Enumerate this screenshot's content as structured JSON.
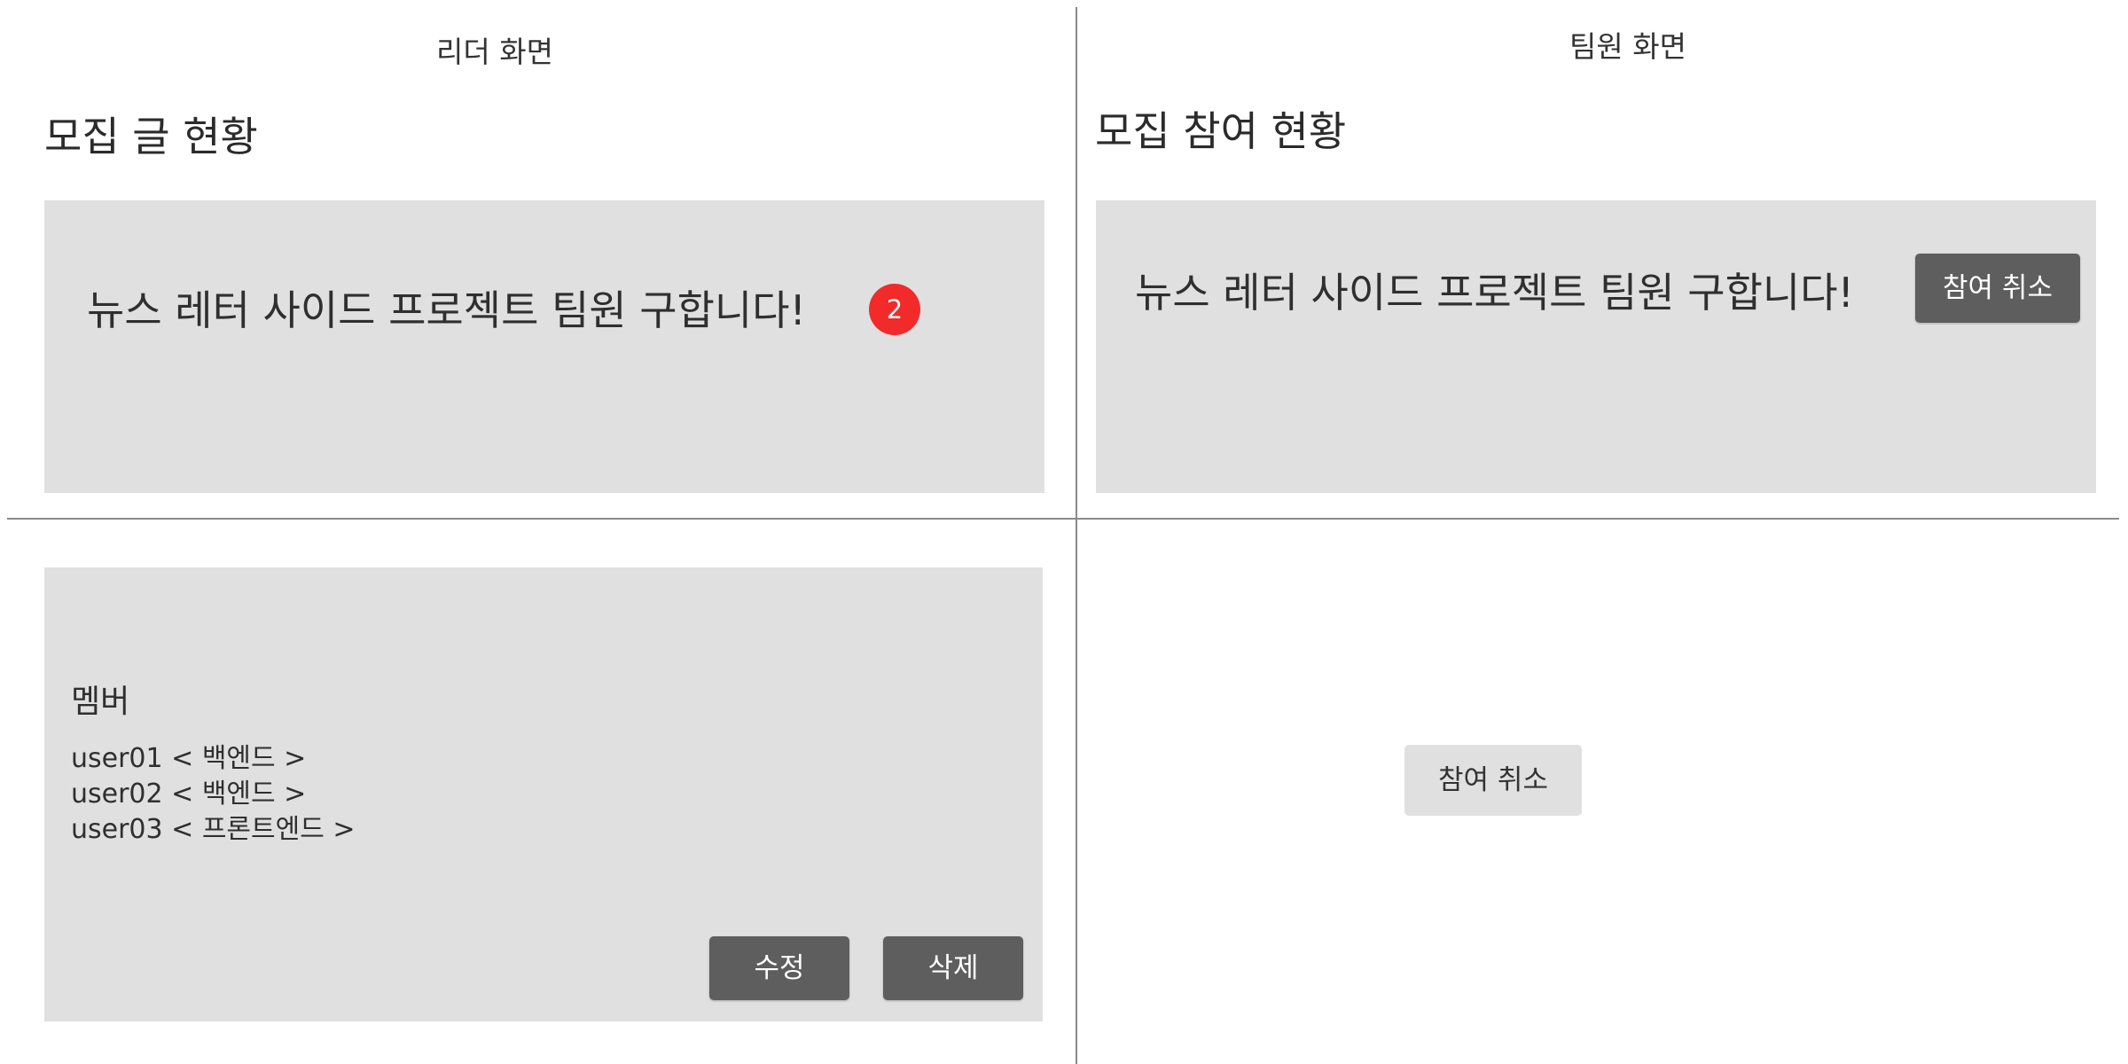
{
  "leader": {
    "screen_label": "리더 화면",
    "section_title": "모집 글 현황",
    "post_title": "뉴스 레터 사이드 프로젝트 팀원 구합니다!",
    "badge_count": "2",
    "members_heading": "멤버",
    "members": [
      "user01 < 백엔드 >",
      "user02 < 백엔드 >",
      "user03 < 프론트엔드 >"
    ],
    "edit_label": "수정",
    "delete_label": "삭제"
  },
  "member": {
    "screen_label": "팀원 화면",
    "section_title": "모집 참여 현황",
    "post_title": "뉴스 레터 사이드 프로젝트 팀원 구합니다!",
    "cancel_label": "참여 취소",
    "cancel_hover_label": "참여 취소"
  },
  "colors": {
    "card_background": "#e0e0e0",
    "dark_button": "#5e5e5e",
    "badge": "#f22a2a",
    "divider": "#8a8a8a"
  }
}
